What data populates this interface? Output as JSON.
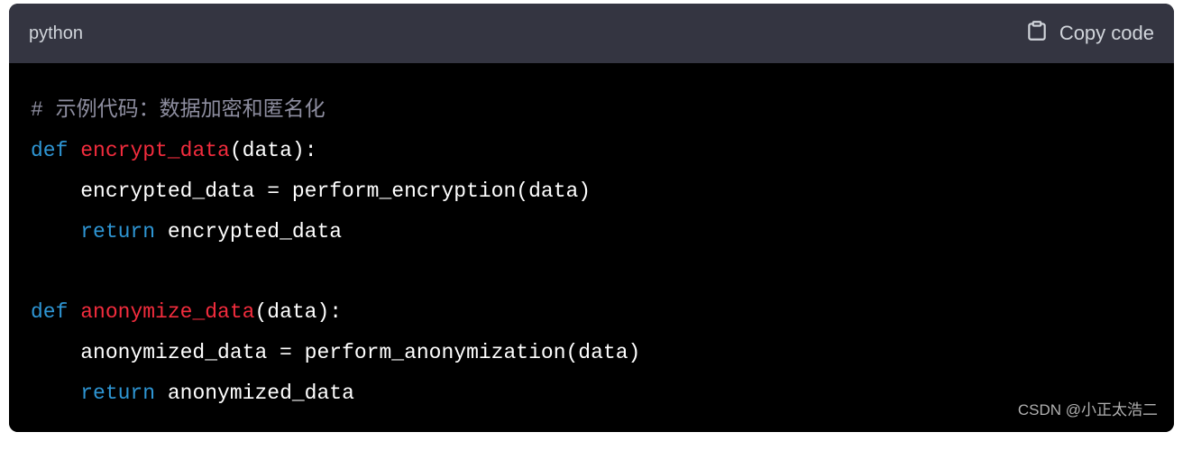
{
  "header": {
    "language": "python",
    "copy_label": "Copy code"
  },
  "code": {
    "lines": [
      {
        "tokens": [
          {
            "cls": "tok-comment",
            "text": "# 示例代码：数据加密和匿名化"
          }
        ]
      },
      {
        "tokens": [
          {
            "cls": "tok-keyword",
            "text": "def"
          },
          {
            "cls": "tok-default",
            "text": " "
          },
          {
            "cls": "tok-funcname",
            "text": "encrypt_data"
          },
          {
            "cls": "tok-default",
            "text": "(data):"
          }
        ]
      },
      {
        "tokens": [
          {
            "cls": "tok-default",
            "text": "    encrypted_data = perform_encryption(data)"
          }
        ]
      },
      {
        "tokens": [
          {
            "cls": "tok-default",
            "text": "    "
          },
          {
            "cls": "tok-keyword",
            "text": "return"
          },
          {
            "cls": "tok-default",
            "text": " encrypted_data"
          }
        ]
      },
      {
        "tokens": [
          {
            "cls": "tok-default",
            "text": ""
          }
        ]
      },
      {
        "tokens": [
          {
            "cls": "tok-keyword",
            "text": "def"
          },
          {
            "cls": "tok-default",
            "text": " "
          },
          {
            "cls": "tok-funcname",
            "text": "anonymize_data"
          },
          {
            "cls": "tok-default",
            "text": "(data):"
          }
        ]
      },
      {
        "tokens": [
          {
            "cls": "tok-default",
            "text": "    anonymized_data = perform_anonymization(data)"
          }
        ]
      },
      {
        "tokens": [
          {
            "cls": "tok-default",
            "text": "    "
          },
          {
            "cls": "tok-keyword",
            "text": "return"
          },
          {
            "cls": "tok-default",
            "text": " anonymized_data"
          }
        ]
      }
    ]
  },
  "watermark": "CSDN @小正太浩二"
}
